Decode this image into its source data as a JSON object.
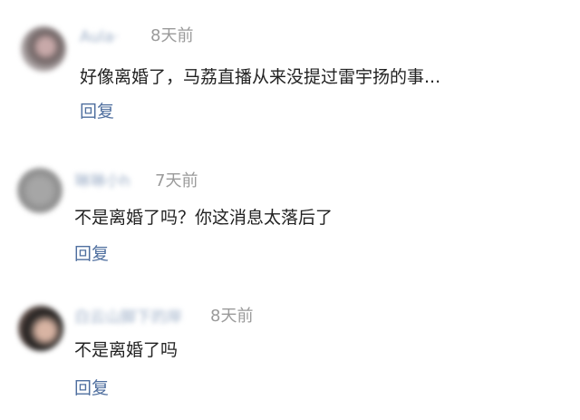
{
  "comments": [
    {
      "username": "Aula·",
      "time": "8天前",
      "text": "好像离婚了，马荔直播从来没提过雷宇扬的事...",
      "reply_label": "回复"
    },
    {
      "username": "琳琳小h",
      "time": "7天前",
      "text": "不是离婚了吗？你这消息太落后了",
      "reply_label": "回复"
    },
    {
      "username": "白云山脚下的岸",
      "time": "8天前",
      "text": "不是离婚了吗",
      "reply_label": "回复"
    }
  ]
}
